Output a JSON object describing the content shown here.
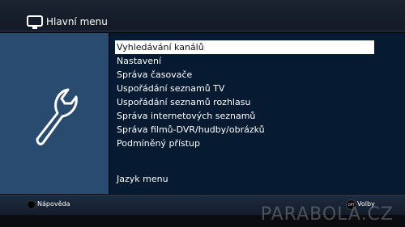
{
  "header": {
    "title": "Hlavní menu",
    "icon": "tv-icon"
  },
  "sidebar": {
    "icon": "wrench-icon"
  },
  "menu": {
    "selected_index": 0,
    "items": [
      "Vyhledávání kanálů",
      "Nastavení",
      "Správa časovače",
      "Uspořádání seznamů TV",
      "Uspořádání seznamů rozhlasu",
      "Správa internetových seznamů",
      "Správa filmů-DVR/hudby/obrázků",
      "Podmíněný přístup"
    ],
    "language_item": "Jazyk menu"
  },
  "footer": {
    "help_label": "Nápověda",
    "options_button": "OPT",
    "options_label": "Volby"
  },
  "watermark": "PARABOLA.CZ",
  "colors": {
    "left_panel": "#2a4b70",
    "main_panel": "#061a32",
    "selection": "#ffffff"
  }
}
